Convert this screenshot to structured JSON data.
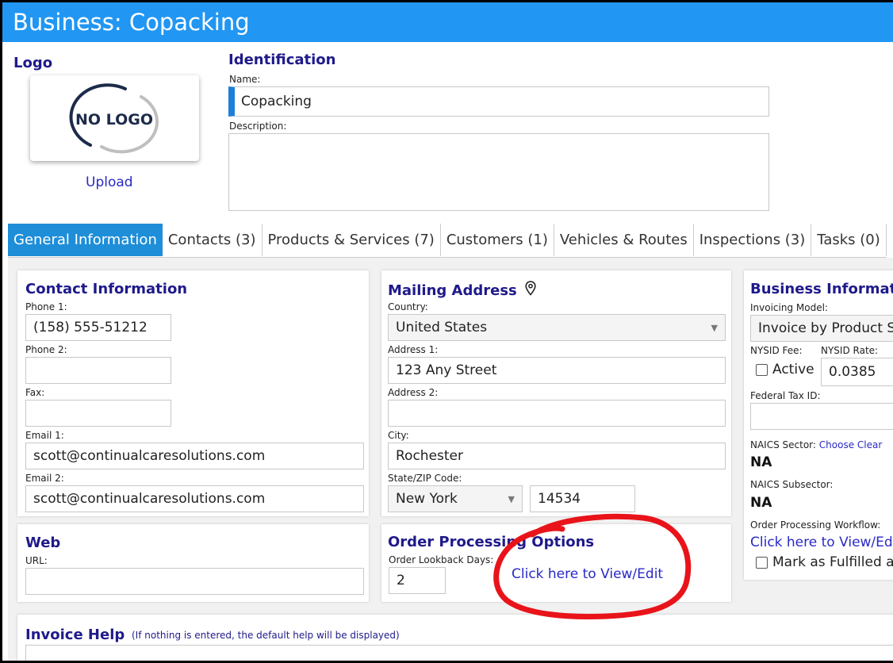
{
  "header": {
    "title": "Business: Copacking"
  },
  "logo": {
    "heading": "Logo",
    "placeholder_text": "NO LOGO",
    "upload_label": "Upload"
  },
  "identification": {
    "heading": "Identification",
    "name_label": "Name:",
    "name_value": "Copacking",
    "description_label": "Description:",
    "description_value": ""
  },
  "tabs": [
    {
      "label": "General Information",
      "active": true
    },
    {
      "label": "Contacts (3)"
    },
    {
      "label": "Products & Services (7)"
    },
    {
      "label": "Customers (1)"
    },
    {
      "label": "Vehicles & Routes"
    },
    {
      "label": "Inspections (3)"
    },
    {
      "label": "Tasks (0)"
    }
  ],
  "contact": {
    "heading": "Contact Information",
    "phone1_label": "Phone 1:",
    "phone1_value": "(158) 555-51212",
    "phone2_label": "Phone 2:",
    "phone2_value": "",
    "fax_label": "Fax:",
    "fax_value": "",
    "email1_label": "Email 1:",
    "email1_value": "scott@continualcaresolutions.com",
    "email2_label": "Email 2:",
    "email2_value": "scott@continualcaresolutions.com"
  },
  "web": {
    "heading": "Web",
    "url_label": "URL:",
    "url_value": ""
  },
  "mailing": {
    "heading": "Mailing Address",
    "country_label": "Country:",
    "country_value": "United States",
    "address1_label": "Address 1:",
    "address1_value": "123 Any Street",
    "address2_label": "Address 2:",
    "address2_value": "",
    "city_label": "City:",
    "city_value": "Rochester",
    "statezip_label": "State/ZIP Code:",
    "state_value": "New York",
    "zip_value": "14534"
  },
  "order_processing": {
    "heading": "Order Processing Options",
    "lookback_label": "Order Lookback Days:",
    "lookback_value": "2",
    "view_edit_link": "Click here to View/Edit"
  },
  "business_info": {
    "heading": "Business Information",
    "invoicing_label": "Invoicing Model:",
    "invoicing_value": "Invoice by Product Sold",
    "nysid_fee_label": "NYSID Fee:",
    "nysid_rate_label": "NYSID Rate:",
    "active_label": "Active",
    "nysid_rate_value": "0.0385",
    "federal_tax_label": "Federal Tax ID:",
    "federal_tax_value": "",
    "naics_sector_label": "NAICS Sector:",
    "naics_sector_link": "Choose Clear",
    "naics_sector_value": "NA",
    "naics_subsector_label": "NAICS Subsector:",
    "naics_subsector_value": "NA",
    "workflow_label": "Order Processing Workflow:",
    "workflow_link": "Click here to View/Edit",
    "fulfilled_label": "Mark as Fulfilled automatically"
  },
  "invoice_help": {
    "heading": "Invoice Help",
    "note": "(If nothing is entered, the default help will be displayed)"
  },
  "colors": {
    "header_bg": "#2196f3",
    "tab_active_bg": "#1e8ed8",
    "heading_text": "#1f1a8a",
    "link": "#2a29c7",
    "annotation_circle": "#e8141a"
  },
  "icons": {
    "mailing_icon": "location-pin-icon",
    "select_icon": "chevron-down-icon"
  }
}
